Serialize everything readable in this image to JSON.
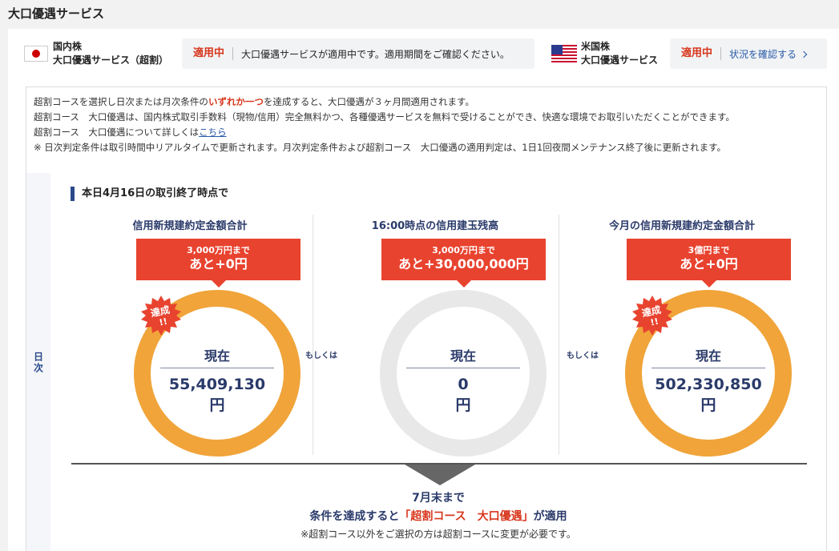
{
  "page": {
    "title": "大口優遇サービス"
  },
  "status": {
    "domestic": {
      "market": "国内株",
      "service": "大口優遇サービス（超割）",
      "badge": "適用中",
      "message": "大口優遇サービスが適用中です。適用期間をご確認ください。"
    },
    "us": {
      "market": "米国株",
      "service": "大口優遇サービス",
      "badge": "適用中",
      "link": "状況を確認する"
    }
  },
  "notes": {
    "line1_pre": "超割コースを選択し日次または月次条件の",
    "line1_em": "いずれか一つ",
    "line1_post": "を達成すると、大口優遇が３ヶ月間適用されます。",
    "line2": "超割コース　大口優遇は、国内株式取引手数料（現物/信用）完全無料かつ、各種優遇サービスを無料で受けることができ、快適な環境でお取引いただくことができます。",
    "line3_pre": "超割コース　大口優遇について詳しくは",
    "line3_link": "こちら",
    "line4": "※ 日次判定条件は取引時間中リアルタイムで更新されます。月次判定条件および超割コース　大口優遇の適用判定は、1日1回夜間メンテナンス終了後に更新されます。"
  },
  "daily": {
    "side_label": "日次",
    "heading": "本日4月16日の取引終了時点で",
    "or_label": "もしくは",
    "current_label": "現在",
    "achieved_label": "達成!!",
    "columns": [
      {
        "title": "信用新規建約定金額合計",
        "target": "3,000万円まで",
        "remaining": "あと+0円",
        "current": "55,409,130",
        "unit": "円",
        "achieved": true
      },
      {
        "title": "16:00時点の信用建玉残高",
        "target": "3,000万円まで",
        "remaining": "あと+30,000,000円",
        "current": "0",
        "unit": "円",
        "achieved": false
      },
      {
        "title": "今月の信用新規建約定金額合計",
        "target": "3億円まで",
        "remaining": "あと+0円",
        "current": "502,330,850",
        "unit": "円",
        "achieved": true
      }
    ],
    "until": "7月末まで",
    "cond_pre": "条件を達成すると",
    "cond_em": "「超割コース　大口優遇」",
    "cond_post": "が適用",
    "footnote": "※超割コース以外をご選択の方は超割コースに変更が必要です。"
  },
  "colors": {
    "accent_red": "#e8432f",
    "ring_orange": "#f0a43a",
    "navy": "#2a3a6a"
  }
}
